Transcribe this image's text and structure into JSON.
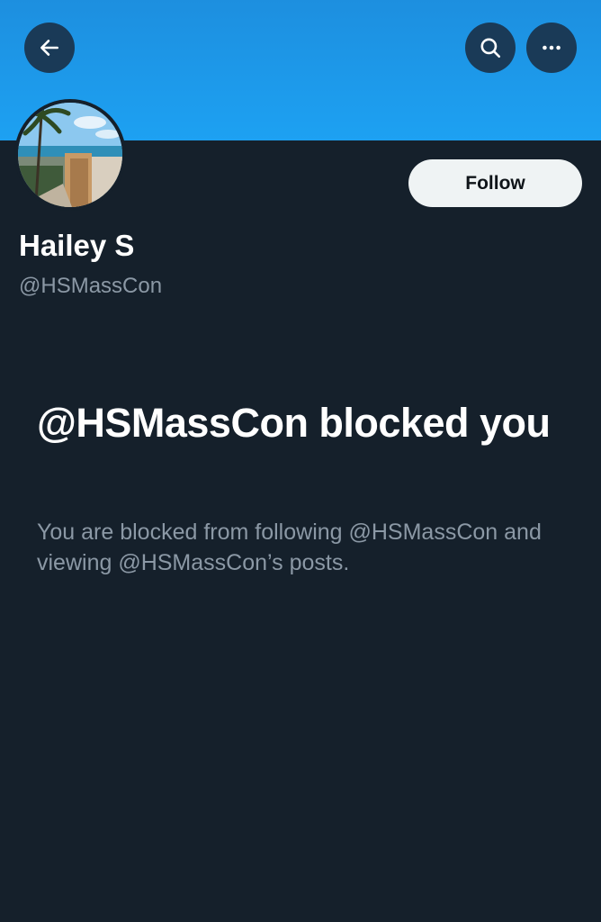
{
  "header": {
    "back_icon": "arrow-left-icon",
    "search_icon": "search-icon",
    "more_icon": "more-horizontal-icon",
    "banner_color": "#1da1f2"
  },
  "profile": {
    "display_name": "Hailey S",
    "handle": "@HSMassCon",
    "follow_label": "Follow",
    "avatar": "avatar-photo-beach-palm-tree"
  },
  "blocked": {
    "title": "@HSMassCon blocked you",
    "description": "You are blocked from following @HSMassCon and viewing @HSMassCon’s posts."
  },
  "colors": {
    "background": "#15202b",
    "secondary_text": "#8b98a5",
    "button_bg": "#eff3f4"
  }
}
